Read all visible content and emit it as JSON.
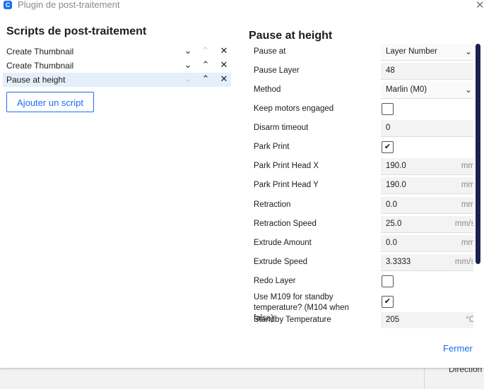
{
  "window": {
    "title": "Plugin de post-traitement",
    "app_icon_letter": "C"
  },
  "scripts": {
    "heading": "Scripts de post-traitement",
    "items": [
      {
        "name": "Create Thumbnail",
        "selected": false,
        "up_enabled": false,
        "down_enabled": true
      },
      {
        "name": "Create Thumbnail",
        "selected": false,
        "up_enabled": true,
        "down_enabled": true
      },
      {
        "name": "Pause at height",
        "selected": true,
        "up_enabled": true,
        "down_enabled": false
      }
    ],
    "add_button": "Ajouter un script"
  },
  "settings": {
    "heading": "Pause at height",
    "rows": [
      {
        "label": "Pause at",
        "type": "select",
        "value": "Layer Number"
      },
      {
        "label": "Pause Layer",
        "type": "text",
        "value": "48",
        "unit": ""
      },
      {
        "label": "Method",
        "type": "select",
        "value": "Marlin (M0)"
      },
      {
        "label": "Keep motors engaged",
        "type": "checkbox",
        "checked": false
      },
      {
        "label": "Disarm timeout",
        "type": "text",
        "value": "0",
        "unit": ""
      },
      {
        "label": "Park Print",
        "type": "checkbox",
        "checked": true
      },
      {
        "label": "Park Print Head X",
        "type": "text",
        "value": "190.0",
        "unit": "mm"
      },
      {
        "label": "Park Print Head Y",
        "type": "text",
        "value": "190.0",
        "unit": "mm"
      },
      {
        "label": "Retraction",
        "type": "text",
        "value": "0.0",
        "unit": "mm"
      },
      {
        "label": "Retraction Speed",
        "type": "text",
        "value": "25.0",
        "unit": "mm/s"
      },
      {
        "label": "Extrude Amount",
        "type": "text",
        "value": "0.0",
        "unit": "mm"
      },
      {
        "label": "Extrude Speed",
        "type": "text",
        "value": "3.3333",
        "unit": "mm/s"
      },
      {
        "label": "Redo Layer",
        "type": "checkbox",
        "checked": false
      },
      {
        "label": "Use M109 for standby temperature? (M104 when false)",
        "type": "checkbox",
        "checked": true,
        "multiline": true
      },
      {
        "label": "Standby Temperature",
        "type": "text",
        "value": "205",
        "unit": "°C"
      }
    ]
  },
  "footer": {
    "close_button": "Fermer"
  },
  "background": {
    "partial_label": "Direction"
  },
  "icons": {
    "close": "✕",
    "chevron_down": "⌄",
    "chevron_up": "⌃",
    "remove": "✕",
    "check": "✔"
  },
  "colors": {
    "accent": "#196ef0",
    "scrollbar": "#1b2150",
    "selected_row": "#e5eefb"
  }
}
